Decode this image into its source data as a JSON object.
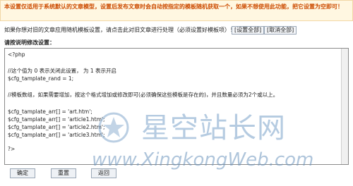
{
  "notice": {
    "text": "本设置仅适用于系统默认的文章模型，设置后发布文章时会自动按指定的模板随机获取一个，如果不想使用此功能，把它设置为空即可！"
  },
  "info": {
    "text": "如果你想对旧的文章应用随机模板设置，请点击此对旧文章进行处理（必须设置好模板项）！",
    "set_all_label": "[设置全部]",
    "cancel_all_label": "[取消全部]"
  },
  "editor": {
    "label": "请按说明修改设置：",
    "lines": [
      "<?php",
      "",
      "//这个值为 0 表示关闭此设置， 为 1 表示开启",
      "$cfg_tamplate_rand = 1;",
      "",
      "//模板数组，如果需要增加，按这个格式增加或修改即可(必须确保这些模板是存在的)，并且数量必须为2个或以上。",
      "",
      "$cfg_tamplate_arr[] = 'art.htm';",
      "$cfg_tamplate_arr[] = 'article1.htm';",
      "$cfg_tamplate_arr[] = 'article2.htm';",
      "$cfg_tamplate_arr[] = 'article3.htm';",
      "",
      "?>"
    ]
  },
  "watermark": {
    "cn": "星空站长网",
    "en": "www.XingkongWeb.com"
  },
  "footer": {
    "ok_label": "确定",
    "reset_label": "重置",
    "back_label": "返回"
  }
}
